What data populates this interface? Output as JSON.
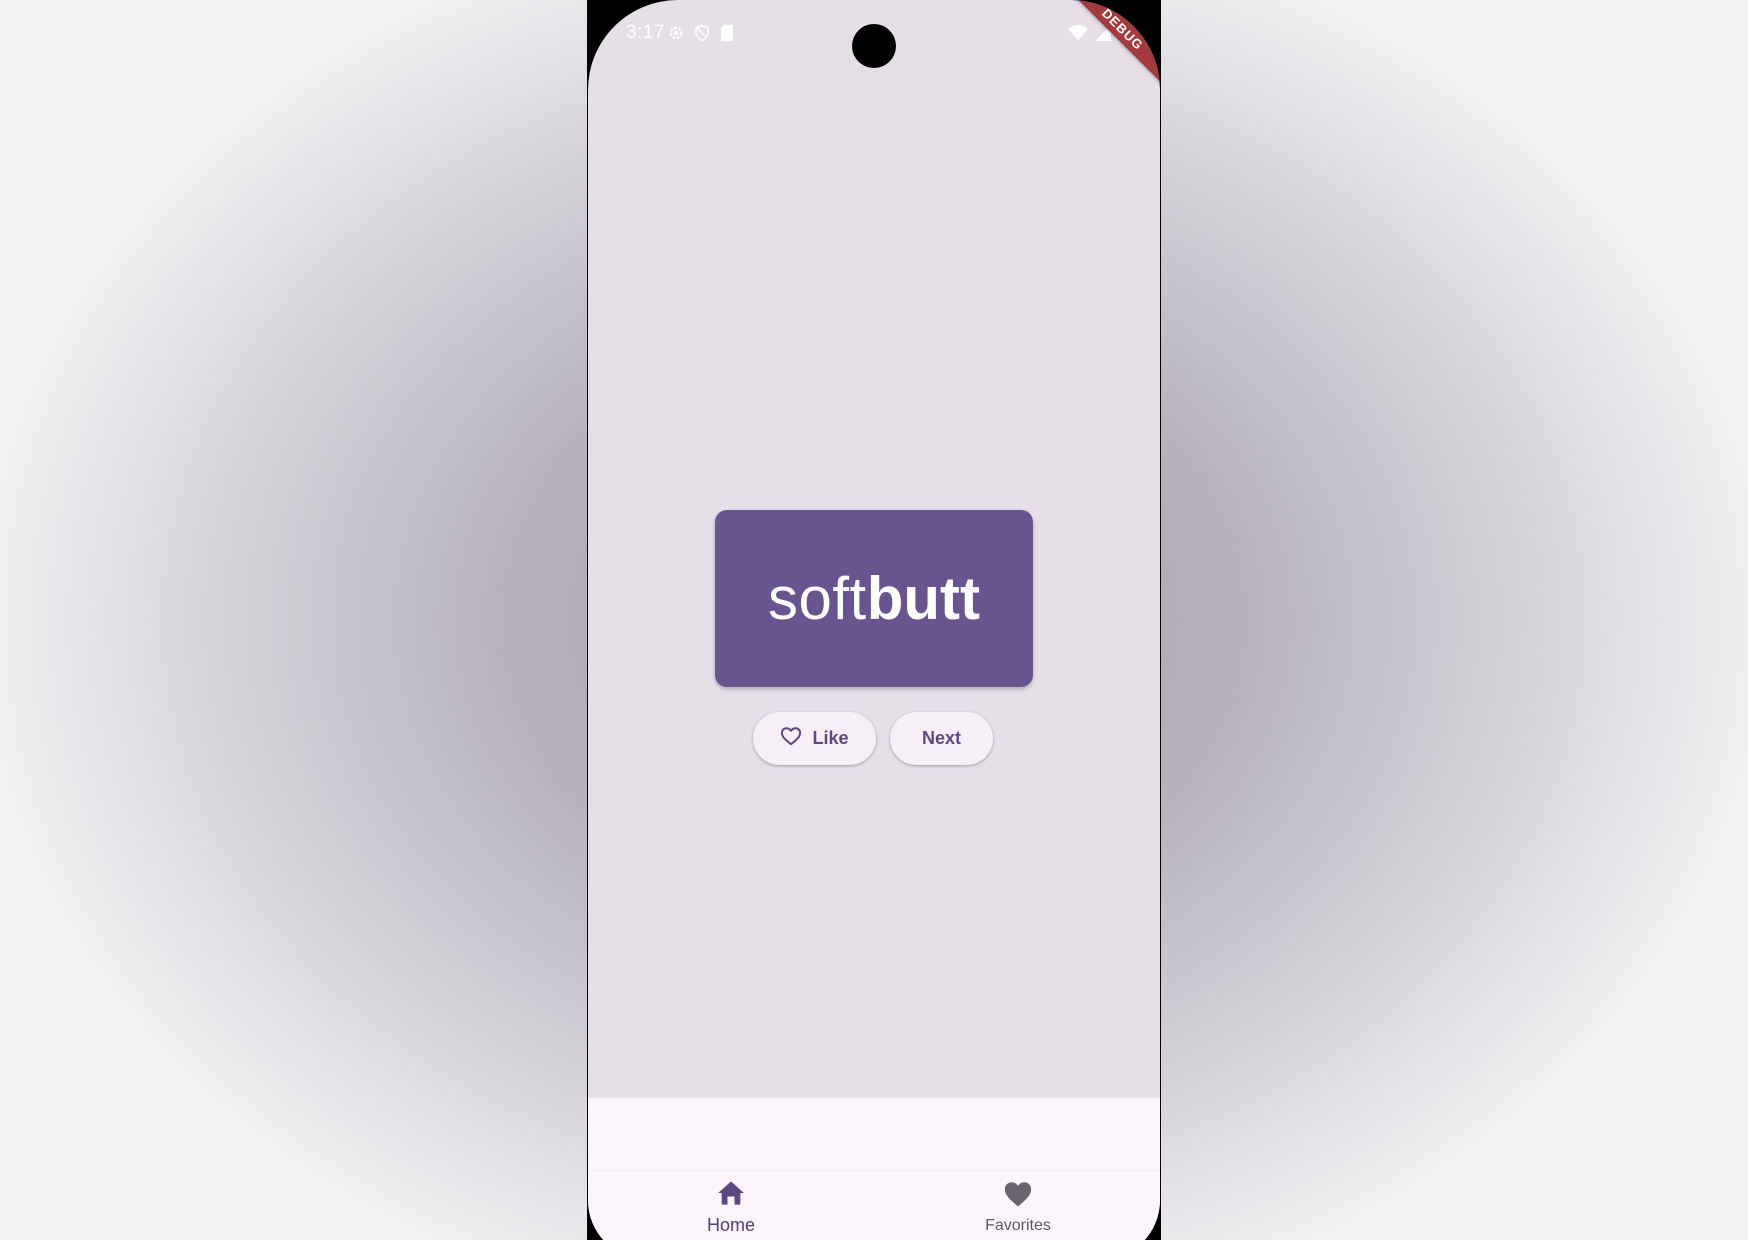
{
  "status_bar": {
    "time": "3:17",
    "left_icons": [
      "settings-icon",
      "shield-icon",
      "sd-card-icon"
    ],
    "right_icons": [
      "wifi-icon",
      "cell-signal-icon",
      "battery-icon"
    ],
    "debug_label": "DEBUG"
  },
  "main": {
    "word_first": "soft",
    "word_second": "butt",
    "like_button": {
      "icon": "heart-outline-icon",
      "label": "Like"
    },
    "next_button": {
      "label": "Next"
    }
  },
  "nav": {
    "items": [
      {
        "icon": "home-icon",
        "label": "Home",
        "selected": true
      },
      {
        "icon": "heart-icon",
        "label": "Favorites",
        "selected": false
      }
    ]
  },
  "colors": {
    "card": "#6a548f",
    "background": "#e6dfe8",
    "nav_background": "#fcf5fc",
    "button_background": "#f6eff8",
    "button_text": "#5b4a80",
    "debug_ribbon": "#a33b3e"
  }
}
